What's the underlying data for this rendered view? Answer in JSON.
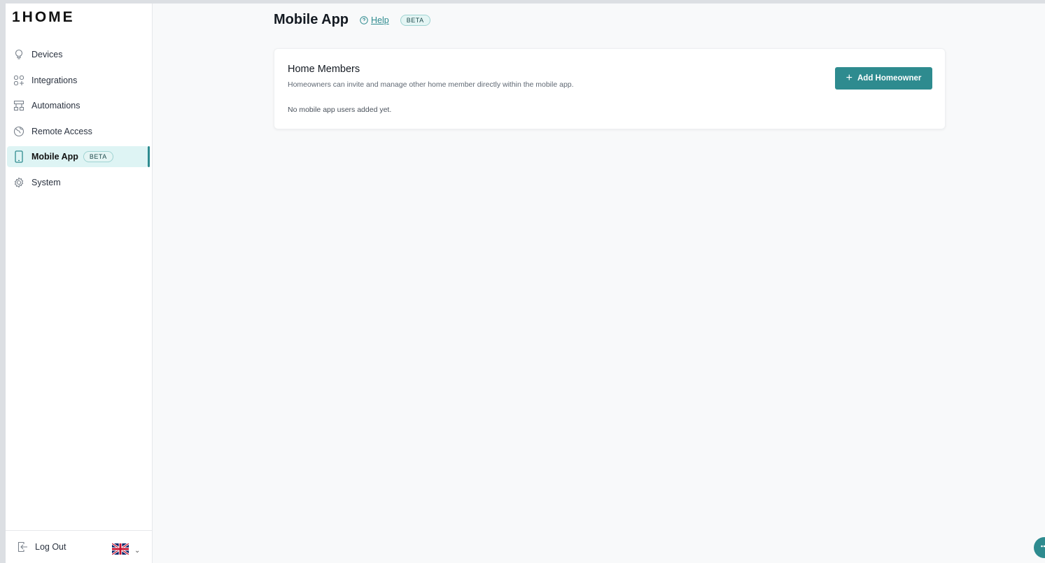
{
  "brand": {
    "logo_text": "1HOME"
  },
  "sidebar": {
    "items": [
      {
        "label": "Devices",
        "icon": "lightbulb-icon"
      },
      {
        "label": "Integrations",
        "icon": "integrations-icon"
      },
      {
        "label": "Automations",
        "icon": "automations-icon"
      },
      {
        "label": "Remote Access",
        "icon": "globe-icon"
      },
      {
        "label": "Mobile App",
        "icon": "phone-icon",
        "badge": "BETA",
        "active": true
      },
      {
        "label": "System",
        "icon": "gear-icon"
      }
    ],
    "footer": {
      "logout_label": "Log Out",
      "language_icon": "uk-flag-icon"
    }
  },
  "main": {
    "title": "Mobile App",
    "help_label": "Help",
    "badge": "BETA",
    "card": {
      "title": "Home Members",
      "subtitle": "Homeowners can invite and manage other home member directly within the mobile app.",
      "empty_text": "No mobile app users added yet.",
      "add_button_label": "Add Homeowner"
    }
  },
  "colors": {
    "accent": "#2e8b8f",
    "active_bg": "#def4f4",
    "background": "#f8f9fa"
  }
}
